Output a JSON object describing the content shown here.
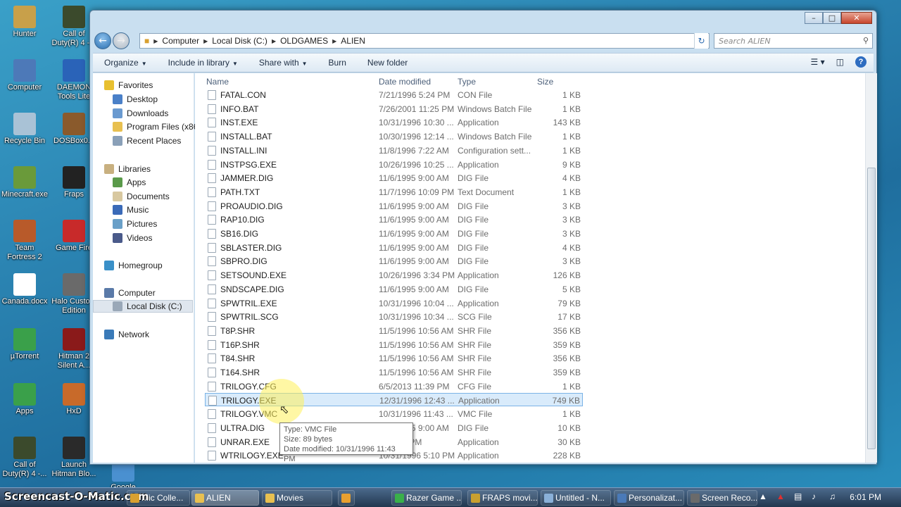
{
  "desktop": {
    "icons": [
      {
        "label": "Hunter",
        "color": "#c8a04a"
      },
      {
        "label": "Call of Duty(R) 4 -...",
        "color": "#3b4a2c"
      },
      {
        "label": "Computer",
        "color": "#4d79b8"
      },
      {
        "label": "DAEMON Tools Lite",
        "color": "#2a63b8"
      },
      {
        "label": "Recycle Bin",
        "color": "#a9c2d6"
      },
      {
        "label": "DOSBox0...",
        "color": "#8a5a2c"
      },
      {
        "label": "Minecraft.exe",
        "color": "#6a9a3a"
      },
      {
        "label": "Fraps",
        "color": "#222222"
      },
      {
        "label": "Team Fortress 2",
        "color": "#b85a2a"
      },
      {
        "label": "Game Fire",
        "color": "#c82a2a"
      },
      {
        "label": "Canada.docx",
        "color": "#ffffff"
      },
      {
        "label": "Halo Custom Edition",
        "color": "#6a6a6a"
      },
      {
        "label": "µTorrent",
        "color": "#3aa04a"
      },
      {
        "label": "Hitman 2 Silent A...",
        "color": "#8a1a1a"
      },
      {
        "label": "Apps",
        "color": "#3aa04a"
      },
      {
        "label": "HxD",
        "color": "#c86a2a"
      },
      {
        "label": "Call of Duty(R) 4 -...",
        "color": "#3b4a2c"
      },
      {
        "label": "Launch Hitman Blo...",
        "color": "#2a2a2a"
      },
      {
        "label": "Google Chrome",
        "color": "#4a90d0"
      }
    ]
  },
  "window": {
    "breadcrumb": [
      "Computer",
      "Local Disk (C:)",
      "OLDGAMES",
      "ALIEN"
    ],
    "search_placeholder": "Search ALIEN",
    "toolbar": {
      "organize": "Organize",
      "include": "Include in library",
      "share": "Share with",
      "burn": "Burn",
      "new_folder": "New folder"
    },
    "nav": {
      "favorites": "Favorites",
      "desktop": "Desktop",
      "downloads": "Downloads",
      "program_files": "Program Files (x86)",
      "recent": "Recent Places",
      "libraries": "Libraries",
      "apps": "Apps",
      "documents": "Documents",
      "music": "Music",
      "pictures": "Pictures",
      "videos": "Videos",
      "homegroup": "Homegroup",
      "computer": "Computer",
      "local_disk": "Local Disk (C:)",
      "network": "Network"
    },
    "columns": {
      "name": "Name",
      "date": "Date modified",
      "type": "Type",
      "size": "Size"
    },
    "files": [
      {
        "name": "FATAL.CON",
        "date": "7/21/1996 5:24 PM",
        "type": "CON File",
        "size": "1 KB"
      },
      {
        "name": "INFO.BAT",
        "date": "7/26/2001 11:25 PM",
        "type": "Windows Batch File",
        "size": "1 KB"
      },
      {
        "name": "INST.EXE",
        "date": "10/31/1996 10:30 ...",
        "type": "Application",
        "size": "143 KB"
      },
      {
        "name": "INSTALL.BAT",
        "date": "10/30/1996 12:14 ...",
        "type": "Windows Batch File",
        "size": "1 KB"
      },
      {
        "name": "INSTALL.INI",
        "date": "11/8/1996 7:22 AM",
        "type": "Configuration sett...",
        "size": "1 KB"
      },
      {
        "name": "INSTPSG.EXE",
        "date": "10/26/1996 10:25 ...",
        "type": "Application",
        "size": "9 KB"
      },
      {
        "name": "JAMMER.DIG",
        "date": "11/6/1995 9:00 AM",
        "type": "DIG File",
        "size": "4 KB"
      },
      {
        "name": "PATH.TXT",
        "date": "11/7/1996 10:09 PM",
        "type": "Text Document",
        "size": "1 KB"
      },
      {
        "name": "PROAUDIO.DIG",
        "date": "11/6/1995 9:00 AM",
        "type": "DIG File",
        "size": "3 KB"
      },
      {
        "name": "RAP10.DIG",
        "date": "11/6/1995 9:00 AM",
        "type": "DIG File",
        "size": "3 KB"
      },
      {
        "name": "SB16.DIG",
        "date": "11/6/1995 9:00 AM",
        "type": "DIG File",
        "size": "3 KB"
      },
      {
        "name": "SBLASTER.DIG",
        "date": "11/6/1995 9:00 AM",
        "type": "DIG File",
        "size": "4 KB"
      },
      {
        "name": "SBPRO.DIG",
        "date": "11/6/1995 9:00 AM",
        "type": "DIG File",
        "size": "3 KB"
      },
      {
        "name": "SETSOUND.EXE",
        "date": "10/26/1996 3:34 PM",
        "type": "Application",
        "size": "126 KB"
      },
      {
        "name": "SNDSCAPE.DIG",
        "date": "11/6/1995 9:00 AM",
        "type": "DIG File",
        "size": "5 KB"
      },
      {
        "name": "SPWTRIL.EXE",
        "date": "10/31/1996 10:04 ...",
        "type": "Application",
        "size": "79 KB"
      },
      {
        "name": "SPWTRIL.SCG",
        "date": "10/31/1996 10:34 ...",
        "type": "SCG File",
        "size": "17 KB"
      },
      {
        "name": "T8P.SHR",
        "date": "11/5/1996 10:56 AM",
        "type": "SHR File",
        "size": "356 KB"
      },
      {
        "name": "T16P.SHR",
        "date": "11/5/1996 10:56 AM",
        "type": "SHR File",
        "size": "359 KB"
      },
      {
        "name": "T84.SHR",
        "date": "11/5/1996 10:56 AM",
        "type": "SHR File",
        "size": "356 KB"
      },
      {
        "name": "T164.SHR",
        "date": "11/5/1996 10:56 AM",
        "type": "SHR File",
        "size": "359 KB"
      },
      {
        "name": "TRILOGY.CFG",
        "date": "6/5/2013 11:39 PM",
        "type": "CFG File",
        "size": "1 KB"
      },
      {
        "name": "TRILOGY.EXE",
        "date": "12/31/1996 12:43 ...",
        "type": "Application",
        "size": "749 KB",
        "selected": true
      },
      {
        "name": "TRILOGY.VMC",
        "date": "10/31/1996 11:43 ...",
        "type": "VMC File",
        "size": "1 KB"
      },
      {
        "name": "ULTRA.DIG",
        "date": "11/6/1995 9:00 AM",
        "type": "DIG File",
        "size": "10 KB"
      },
      {
        "name": "UNRAR.EXE",
        "date": "...12:53 PM",
        "type": "Application",
        "size": "30 KB"
      },
      {
        "name": "WTRILOGY.EXE",
        "date": "10/31/1996 5:10 PM",
        "type": "Application",
        "size": "228 KB"
      }
    ],
    "tooltip": {
      "type": "Type: VMC File",
      "size": "Size: 89 bytes",
      "date": "Date modified: 10/31/1996 11:43 PM"
    }
  },
  "taskbar": {
    "brand": "Screencast-O-Matic.com",
    "tasks": [
      {
        "label": "...ic Colle...",
        "color": "#d8a030"
      },
      {
        "label": "ALIEN",
        "color": "#e8c050",
        "active": true
      },
      {
        "label": "Movies",
        "color": "#e8c050"
      },
      {
        "label": "",
        "color": "#e8a030"
      },
      {
        "label": "Razer Game ...",
        "color": "#3ab04a"
      },
      {
        "label": "FRAPS movi...",
        "color": "#c8a030"
      },
      {
        "label": "Untitled - N...",
        "color": "#8ab0d8"
      },
      {
        "label": "Personalizat...",
        "color": "#4a7ab8"
      },
      {
        "label": "Screen Reco...",
        "color": "#6a6a6a"
      }
    ],
    "clock": "6:01 PM"
  }
}
